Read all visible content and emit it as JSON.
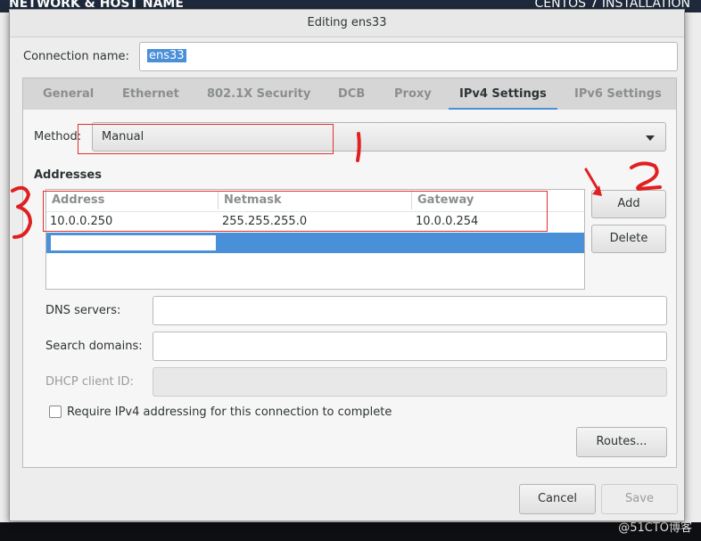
{
  "background": {
    "left_title": "NETWORK & HOST NAME",
    "right_title": "CENTOS 7 INSTALLATION"
  },
  "dialog": {
    "title": "Editing ens33",
    "connection_name_label": "Connection name:",
    "connection_name_value": "ens33"
  },
  "tabs": [
    {
      "label": "General",
      "active": false
    },
    {
      "label": "Ethernet",
      "active": false
    },
    {
      "label": "802.1X Security",
      "active": false
    },
    {
      "label": "DCB",
      "active": false
    },
    {
      "label": "Proxy",
      "active": false
    },
    {
      "label": "IPv4 Settings",
      "active": true
    },
    {
      "label": "IPv6 Settings",
      "active": false
    }
  ],
  "ipv4": {
    "method_label": "Method:",
    "method_value": "Manual",
    "addresses_heading": "Addresses",
    "columns": [
      "Address",
      "Netmask",
      "Gateway"
    ],
    "rows": [
      [
        "10.0.0.250",
        "255.255.255.0",
        "10.0.0.254"
      ]
    ],
    "add_label": "Add",
    "delete_label": "Delete",
    "dns_label": "DNS servers:",
    "dns_value": "",
    "search_label": "Search domains:",
    "search_value": "",
    "dhcp_label": "DHCP client ID:",
    "dhcp_value": "",
    "require_label": "Require IPv4 addressing for this connection to complete",
    "require_checked": false,
    "routes_label": "Routes..."
  },
  "footer": {
    "cancel_label": "Cancel",
    "save_label": "Save"
  },
  "annotations": {
    "mark_1": "1",
    "mark_2": "2",
    "mark_3": "3",
    "color": "#e02020"
  },
  "watermark": "@51CTO博客",
  "colors": {
    "accent": "#4a90d9",
    "annotation_box": "#e03030"
  }
}
